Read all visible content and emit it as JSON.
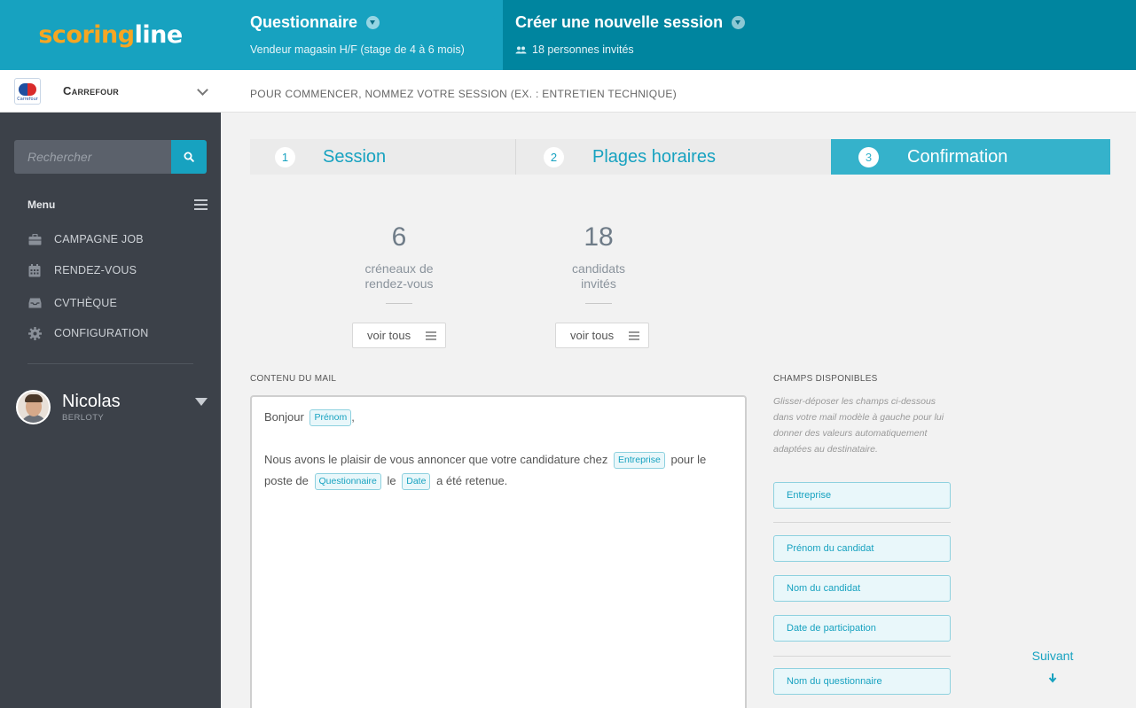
{
  "app": {
    "logo_part1": "scoring",
    "logo_part2": "line",
    "company": "Carrefour",
    "company_logo_text": "Carrefour"
  },
  "search": {
    "placeholder": "Rechercher"
  },
  "menu": {
    "title": "Menu",
    "items": [
      {
        "label": "CAMPAGNE JOB",
        "icon": "briefcase-icon"
      },
      {
        "label": "RENDEZ-VOUS",
        "icon": "calendar-icon"
      },
      {
        "label": "CVTHÈQUE",
        "icon": "inbox-icon"
      },
      {
        "label": "CONFIGURATION",
        "icon": "gear-icon"
      }
    ]
  },
  "user": {
    "first_name": "Nicolas",
    "last_name": "BERLOTY"
  },
  "breadcrumb": {
    "questionnaire_title": "Questionnaire",
    "questionnaire_sub": "Vendeur magasin H/F (stage de 4 à 6 mois)",
    "session_title": "Créer une nouvelle session",
    "session_sub": "18 personnes invités"
  },
  "subheader": "POUR COMMENCER, NOMMEZ VOTRE SESSION (EX. : ENTRETIEN TECHNIQUE)",
  "steps": [
    {
      "num": "1",
      "label": "Session",
      "active": false
    },
    {
      "num": "2",
      "label": "Plages horaires",
      "active": false
    },
    {
      "num": "3",
      "label": "Confirmation",
      "active": true
    }
  ],
  "stats": [
    {
      "value": "6",
      "line1": "créneaux de",
      "line2": "rendez-vous",
      "button": "voir tous"
    },
    {
      "value": "18",
      "line1": "candidats",
      "line2": "invités",
      "button": "voir tous"
    }
  ],
  "mail": {
    "section_label": "CONTENU DU MAIL",
    "greeting": "Bonjour",
    "tag_prenom": "Prénom",
    "comma": ",",
    "line2_a": "Nous avons le plaisir de vous annoncer que votre candidature chez",
    "tag_entreprise": "Entreprise",
    "line2_b": "pour le",
    "line3_a": "poste de",
    "tag_questionnaire": "Questionnaire",
    "line3_b": "le",
    "tag_date": "Date",
    "line3_c": "a été retenue."
  },
  "fields": {
    "section_label": "CHAMPS DISPONIBLES",
    "help": "Glisser-déposer les champs ci-dessous dans votre mail modèle à gauche pour lui donner des valeurs automatiquement adaptées au destinataire.",
    "items": [
      "Entreprise",
      "Prénom du candidat",
      "Nom du candidat",
      "Date de participation",
      "Nom du questionnaire"
    ]
  },
  "next": {
    "label": "Suivant"
  },
  "colors": {
    "accent": "#17a2c0",
    "sidebar": "#3c4149",
    "brand_orange": "#f5a623"
  }
}
